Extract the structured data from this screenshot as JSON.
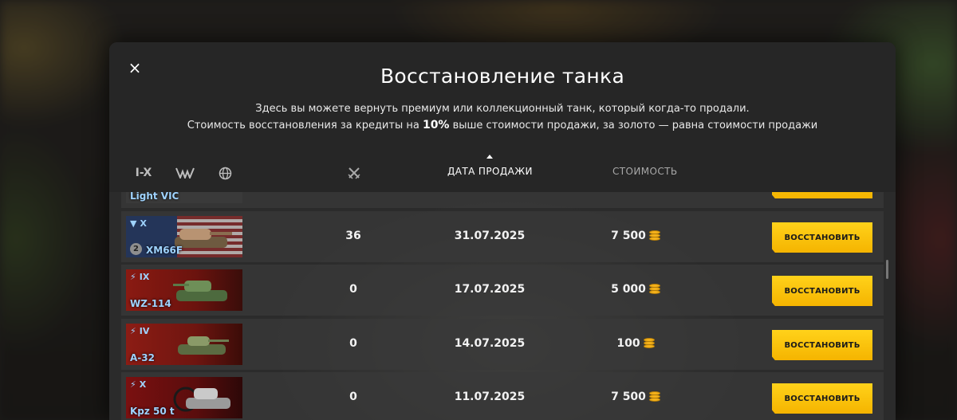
{
  "modal": {
    "title": "Восстановление танка",
    "description_line1": "Здесь вы можете вернуть премиум или коллекционный танк, который когда-то продали.",
    "description_line2_before": "Стоимость восстановления за кредиты на ",
    "description_line2_bold": "10%",
    "description_line2_after": " выше стоимости продажи, за золото — равна стоимости продажи",
    "close_icon": "×"
  },
  "filters": {
    "tier_label": "I-X",
    "type_icon": "vehicle-type-icon",
    "nation_icon": "globe-icon"
  },
  "columns": {
    "battles_icon": "crossed-swords-icon",
    "sale_date": "ДАТА ПРОДАЖИ",
    "cost": "СТОИМОСТЬ",
    "sorted_by": "ДАТА ПРОДАЖИ"
  },
  "rows": [
    {
      "tier": "",
      "name": "Light VIC",
      "nation": "uk",
      "battles": "",
      "date": "",
      "price": "",
      "button": ""
    },
    {
      "tier": "X",
      "name": "XM66F",
      "nation": "usa",
      "mastery": "2",
      "battles": "36",
      "date": "31.07.2025",
      "price": "7 500",
      "button": "ВОССТАНОВИТЬ"
    },
    {
      "tier": "IX",
      "name": "WZ-114",
      "nation": "china",
      "battles": "0",
      "date": "17.07.2025",
      "price": "5 000",
      "button": "ВОССТАНОВИТЬ"
    },
    {
      "tier": "IV",
      "name": "A-32",
      "nation": "ussr",
      "battles": "0",
      "date": "14.07.2025",
      "price": "100",
      "button": "ВОССТАНОВИТЬ"
    },
    {
      "tier": "X",
      "name": "Kpz 50 t",
      "nation": "germany",
      "battles": "0",
      "date": "11.07.2025",
      "price": "7 500",
      "button": "ВОССТАНОВИТЬ"
    }
  ],
  "colors": {
    "accent_button": "#f5b400",
    "tank_name": "#9fd3ff",
    "gold": "#f5b21b"
  }
}
